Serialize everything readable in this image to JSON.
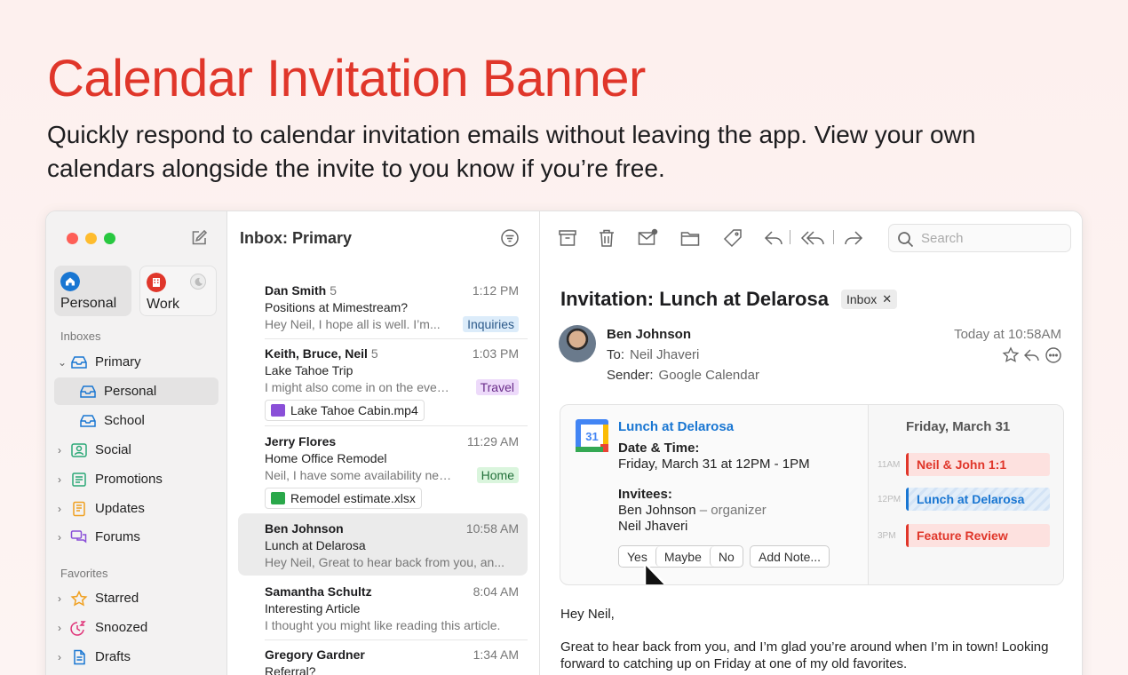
{
  "hero": {
    "title": "Calendar Invitation Banner",
    "subtitle": "Quickly respond to calendar invitation emails without leaving the app. View your own calendars alongside the invite to you know if you’re free."
  },
  "colors": {
    "accent": "#e0362a",
    "link": "#1976d2"
  },
  "sidebar": {
    "accounts": [
      {
        "label": "Personal",
        "icon": "home-icon"
      },
      {
        "label": "Work",
        "icon": "building-icon"
      }
    ],
    "inboxes_title": "Inboxes",
    "items": [
      {
        "label": "Primary",
        "icon": "inbox-icon"
      },
      {
        "label": "Personal",
        "icon": "inbox-icon"
      },
      {
        "label": "School",
        "icon": "inbox-icon"
      },
      {
        "label": "Social",
        "icon": "people-icon"
      },
      {
        "label": "Promotions",
        "icon": "promotions-icon"
      },
      {
        "label": "Updates",
        "icon": "updates-icon"
      },
      {
        "label": "Forums",
        "icon": "forums-icon"
      }
    ],
    "favorites_title": "Favorites",
    "favorites": [
      {
        "label": "Starred",
        "icon": "star-icon"
      },
      {
        "label": "Snoozed",
        "icon": "snooze-icon"
      },
      {
        "label": "Drafts",
        "icon": "draft-icon"
      }
    ]
  },
  "list": {
    "title": "Inbox: Primary",
    "messages": [
      {
        "sender": "Dan Smith",
        "count": "5",
        "time": "1:12 PM",
        "subject": "Positions at Mimestream?",
        "preview": "Hey Neil, I hope all is well. I’m...",
        "tag": "Inquiries",
        "tag_color": "#dcecfa"
      },
      {
        "sender": "Keith, Bruce, Neil",
        "count": "5",
        "time": "1:03 PM",
        "subject": "Lake Tahoe Trip",
        "preview": "I might also come in on the eveni...",
        "tag": "Travel",
        "tag_color": "#eddafa",
        "attachment": "Lake Tahoe Cabin.mp4"
      },
      {
        "sender": "Jerry Flores",
        "count": "",
        "time": "11:29 AM",
        "subject": "Home Office Remodel",
        "preview": "Neil, I have some availability next...",
        "tag": "Home",
        "tag_color": "#daf5dd",
        "attachment": "Remodel estimate.xlsx"
      },
      {
        "sender": "Ben Johnson",
        "count": "",
        "time": "10:58 AM",
        "subject": "Lunch at Delarosa",
        "preview": "Hey Neil, Great to hear back from you, an..."
      },
      {
        "sender": "Samantha Schultz",
        "count": "",
        "time": "8:04 AM",
        "subject": "Interesting Article",
        "preview": "I thought you might like reading this article."
      },
      {
        "sender": "Gregory Gardner",
        "count": "",
        "time": "1:34 AM",
        "subject": "Referral?",
        "preview": ""
      }
    ]
  },
  "detail": {
    "search_placeholder": "Search",
    "subject": "Invitation: Lunch at Delarosa",
    "label_chip": "Inbox",
    "from": "Ben Johnson",
    "to_label": "To:",
    "to": "Neil Jhaveri",
    "sender_label": "Sender:",
    "sender": "Google Calendar",
    "time": "Today at 10:58AM",
    "invite": {
      "title": "Lunch at Delarosa",
      "datetime_label": "Date & Time:",
      "datetime": "Friday, March 31 at 12PM - 1PM",
      "invitees_label": "Invitees:",
      "invitee1": "Ben Johnson",
      "invitee1_role": "– organizer",
      "invitee2": "Neil Jhaveri",
      "yes": "Yes",
      "maybe": "Maybe",
      "no": "No",
      "add_note": "Add Note...",
      "cal_date": "Friday, March 31",
      "cal_icon_num": "31",
      "events": [
        {
          "hour": "11AM",
          "title": "Neil & John 1:1",
          "kind": "red"
        },
        {
          "hour": "12PM",
          "title": "Lunch at Delarosa",
          "kind": "blue"
        },
        {
          "hour": "3PM",
          "title": "Feature Review",
          "kind": "red"
        }
      ]
    },
    "body_greeting": "Hey Neil,",
    "body_p1": "Great to hear back from you, and I’m glad you’re around when I’m in town! Looking forward to catching up on Friday at one of my old favorites."
  }
}
